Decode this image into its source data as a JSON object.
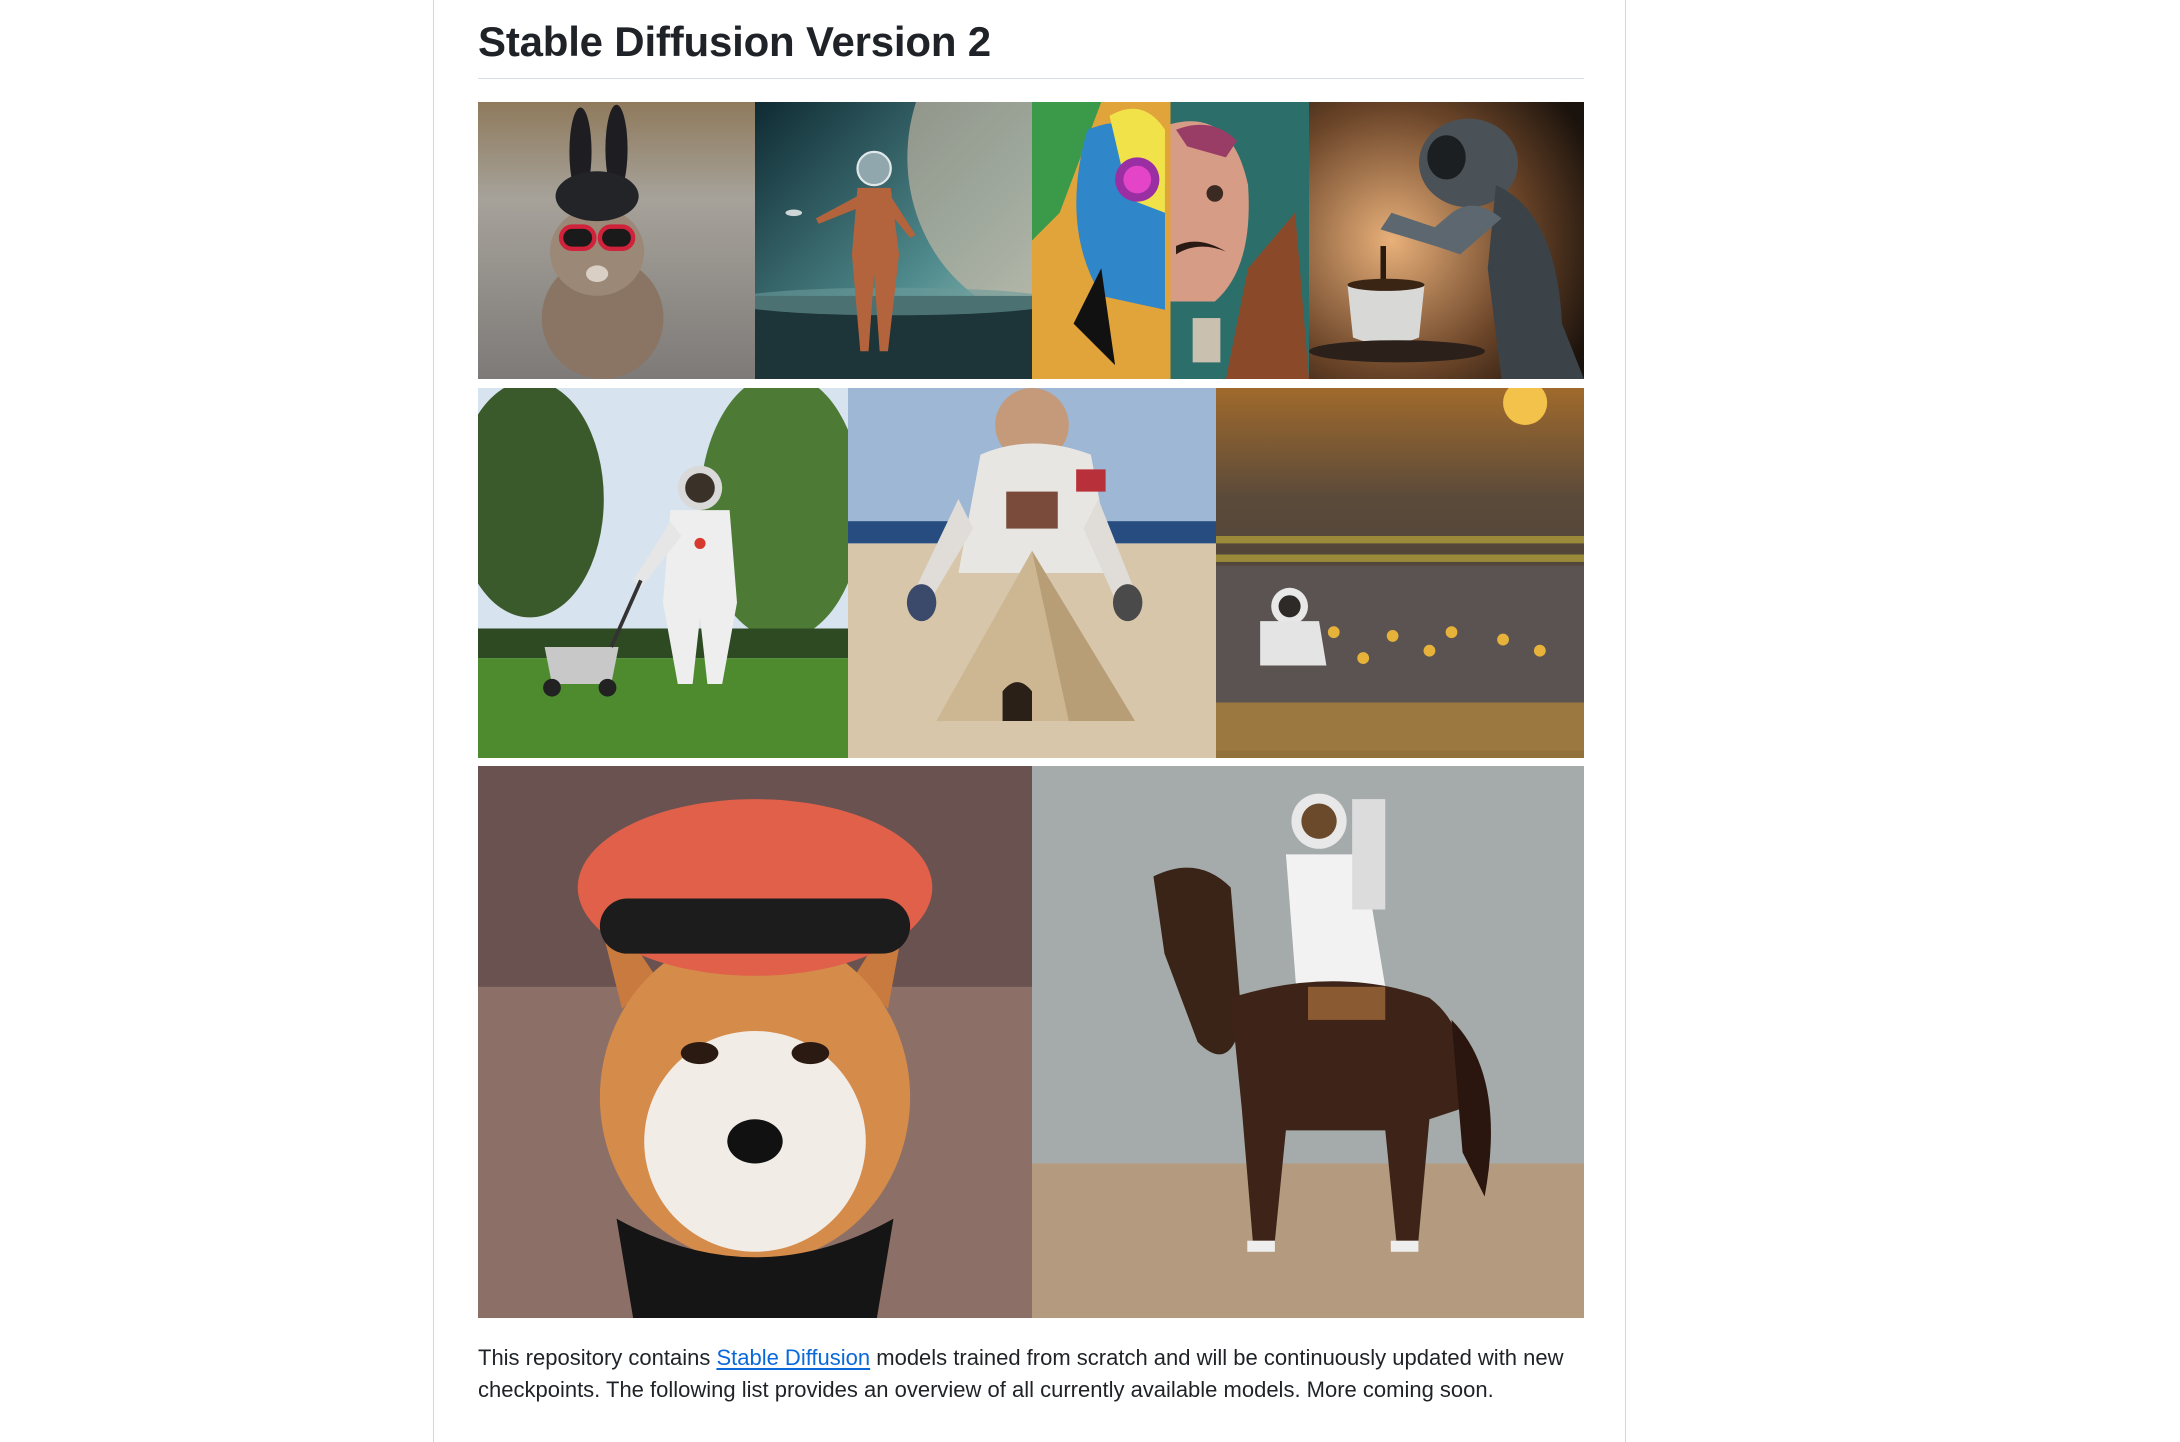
{
  "readme": {
    "title": "Stable Diffusion Version 2",
    "description": {
      "before_link": "This repository contains ",
      "link_text": "Stable Diffusion",
      "after_link": " models trained from scratch and will be continuously updated with new checkpoints. The following list provides an overview of all currently available models. More coming soon."
    },
    "colors": {
      "text": "#1f2328",
      "link": "#0969da",
      "border": "#d0d7de"
    }
  },
  "gallery": {
    "images": [
      {
        "subject": "rabbit-with-sunglasses"
      },
      {
        "subject": "astronaut-on-alien-shore"
      },
      {
        "subject": "surreal-portrait-painting"
      },
      {
        "subject": "robot-pouring-coffee"
      },
      {
        "subject": "astronaut-mowing-lawn"
      },
      {
        "subject": "astronaut-building-sand-pyramid"
      },
      {
        "subject": "astronaut-with-ducklings"
      },
      {
        "subject": "shiba-inu-with-red-beret"
      },
      {
        "subject": "astronaut-riding-horse"
      }
    ]
  }
}
